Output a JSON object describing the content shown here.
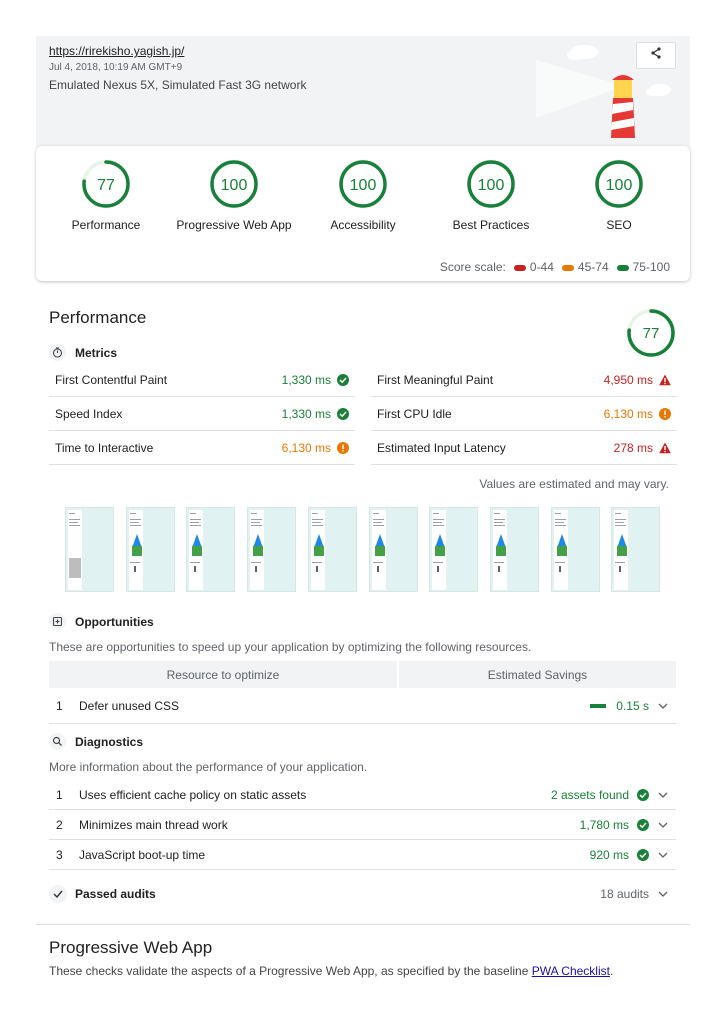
{
  "header": {
    "url": "https://rirekisho.yagish.jp/",
    "date": "Jul 4, 2018, 10:19 AM GMT+9",
    "environment": "Emulated Nexus 5X, Simulated Fast 3G network"
  },
  "categories": [
    {
      "label": "Performance",
      "score": "77",
      "score_value": 77,
      "color": "#188038"
    },
    {
      "label": "Progressive Web App",
      "score": "100",
      "score_value": 100,
      "color": "#188038"
    },
    {
      "label": "Accessibility",
      "score": "100",
      "score_value": 100,
      "color": "#188038"
    },
    {
      "label": "Best Practices",
      "score": "100",
      "score_value": 100,
      "color": "#188038"
    },
    {
      "label": "SEO",
      "score": "100",
      "score_value": 100,
      "color": "#188038"
    }
  ],
  "score_scale": {
    "label": "Score scale:",
    "ranges": [
      {
        "label": "0-44",
        "color": "#c5221f"
      },
      {
        "label": "45-74",
        "color": "#e67700"
      },
      {
        "label": "75-100",
        "color": "#188038"
      }
    ]
  },
  "performance": {
    "title": "Performance",
    "score": "77",
    "score_value": 77,
    "metrics_title": "Metrics",
    "metrics": [
      {
        "name": "First Contentful Paint",
        "value": "1,330 ms",
        "status": "pass"
      },
      {
        "name": "First Meaningful Paint",
        "value": "4,950 ms",
        "status": "fail"
      },
      {
        "name": "Speed Index",
        "value": "1,330 ms",
        "status": "pass"
      },
      {
        "name": "First CPU Idle",
        "value": "6,130 ms",
        "status": "average"
      },
      {
        "name": "Time to Interactive",
        "value": "6,130 ms",
        "status": "average"
      },
      {
        "name": "Estimated Input Latency",
        "value": "278 ms",
        "status": "fail"
      }
    ],
    "estimate_note": "Values are estimated and may vary.",
    "filmstrip_frames": 10,
    "opportunities": {
      "title": "Opportunities",
      "description": "These are opportunities to speed up your application by optimizing the following resources.",
      "col_resource": "Resource to optimize",
      "col_savings": "Estimated Savings",
      "items": [
        {
          "num": "1",
          "name": "Defer unused CSS",
          "value": "0.15 s"
        }
      ]
    },
    "diagnostics": {
      "title": "Diagnostics",
      "description": "More information about the performance of your application.",
      "items": [
        {
          "num": "1",
          "name": "Uses efficient cache policy on static assets",
          "value": "2 assets found"
        },
        {
          "num": "2",
          "name": "Minimizes main thread work",
          "value": "1,780 ms"
        },
        {
          "num": "3",
          "name": "JavaScript boot-up time",
          "value": "920 ms"
        }
      ]
    },
    "passed": {
      "title": "Passed audits",
      "value": "18 audits"
    }
  },
  "pwa": {
    "title": "Progressive Web App",
    "description_prefix": "These checks validate the aspects of a Progressive Web App, as specified by the baseline ",
    "link": "PWA Checklist",
    "description_suffix": "."
  }
}
